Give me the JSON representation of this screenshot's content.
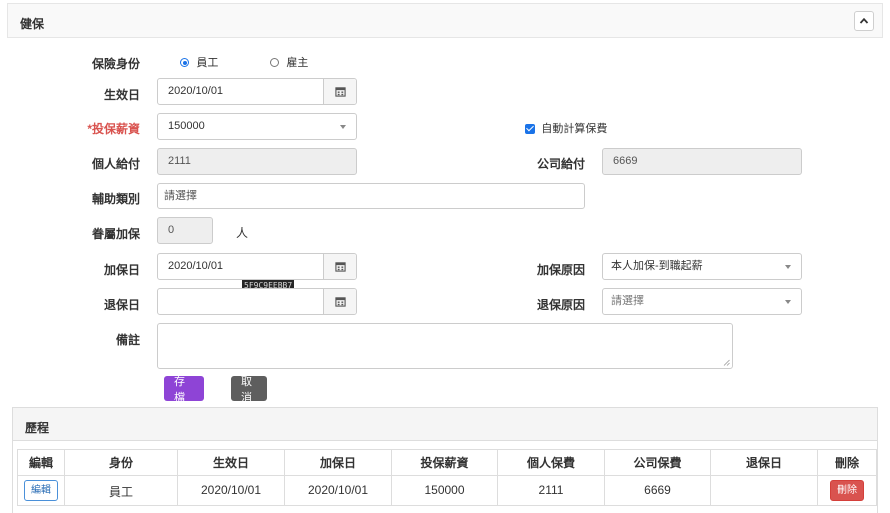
{
  "panel": {
    "title": "健保"
  },
  "form": {
    "identity": {
      "label": "保險身份",
      "options": [
        "員工",
        "雇主"
      ],
      "selected": "員工"
    },
    "effective_date": {
      "label": "生效日",
      "value": "2020/10/01"
    },
    "insured_salary": {
      "label": "*投保薪資",
      "value": "150000"
    },
    "auto_calc": {
      "label": "自動計算保費",
      "checked": true
    },
    "personal_pay": {
      "label": "個人給付",
      "value": "2111"
    },
    "company_pay": {
      "label": "公司給付",
      "value": "6669"
    },
    "subsidy": {
      "label": "輔助類別",
      "placeholder": "請選擇"
    },
    "dependents": {
      "label": "眷屬加保",
      "value": "0",
      "unit": "人"
    },
    "enroll_date": {
      "label": "加保日",
      "value": "2020/10/01",
      "overlay_text": "5F9C9EEBB7"
    },
    "enroll_reason": {
      "label": "加保原因",
      "value": "本人加保-到職起薪"
    },
    "withdraw_date": {
      "label": "退保日",
      "value": ""
    },
    "withdraw_reason": {
      "label": "退保原因",
      "placeholder": "請選擇"
    },
    "notes": {
      "label": "備註",
      "value": ""
    }
  },
  "actions": {
    "save": "存檔",
    "cancel": "取消"
  },
  "history": {
    "title": "歷程",
    "columns": [
      "編輯",
      "身份",
      "生效日",
      "加保日",
      "投保薪資",
      "個人保費",
      "公司保費",
      "退保日",
      "刪除"
    ],
    "rows": [
      {
        "edit": "編輯",
        "identity": "員工",
        "effective": "2020/10/01",
        "enroll": "2020/10/01",
        "salary": "150000",
        "personal": "2111",
        "company": "6669",
        "withdraw": "",
        "delete": "刪除"
      }
    ]
  },
  "colors": {
    "accent": "#1a73e8",
    "save_button": "#8e44d6",
    "cancel_button": "#5e5e5e",
    "delete_button": "#d9534f",
    "required": "#d9534f"
  }
}
